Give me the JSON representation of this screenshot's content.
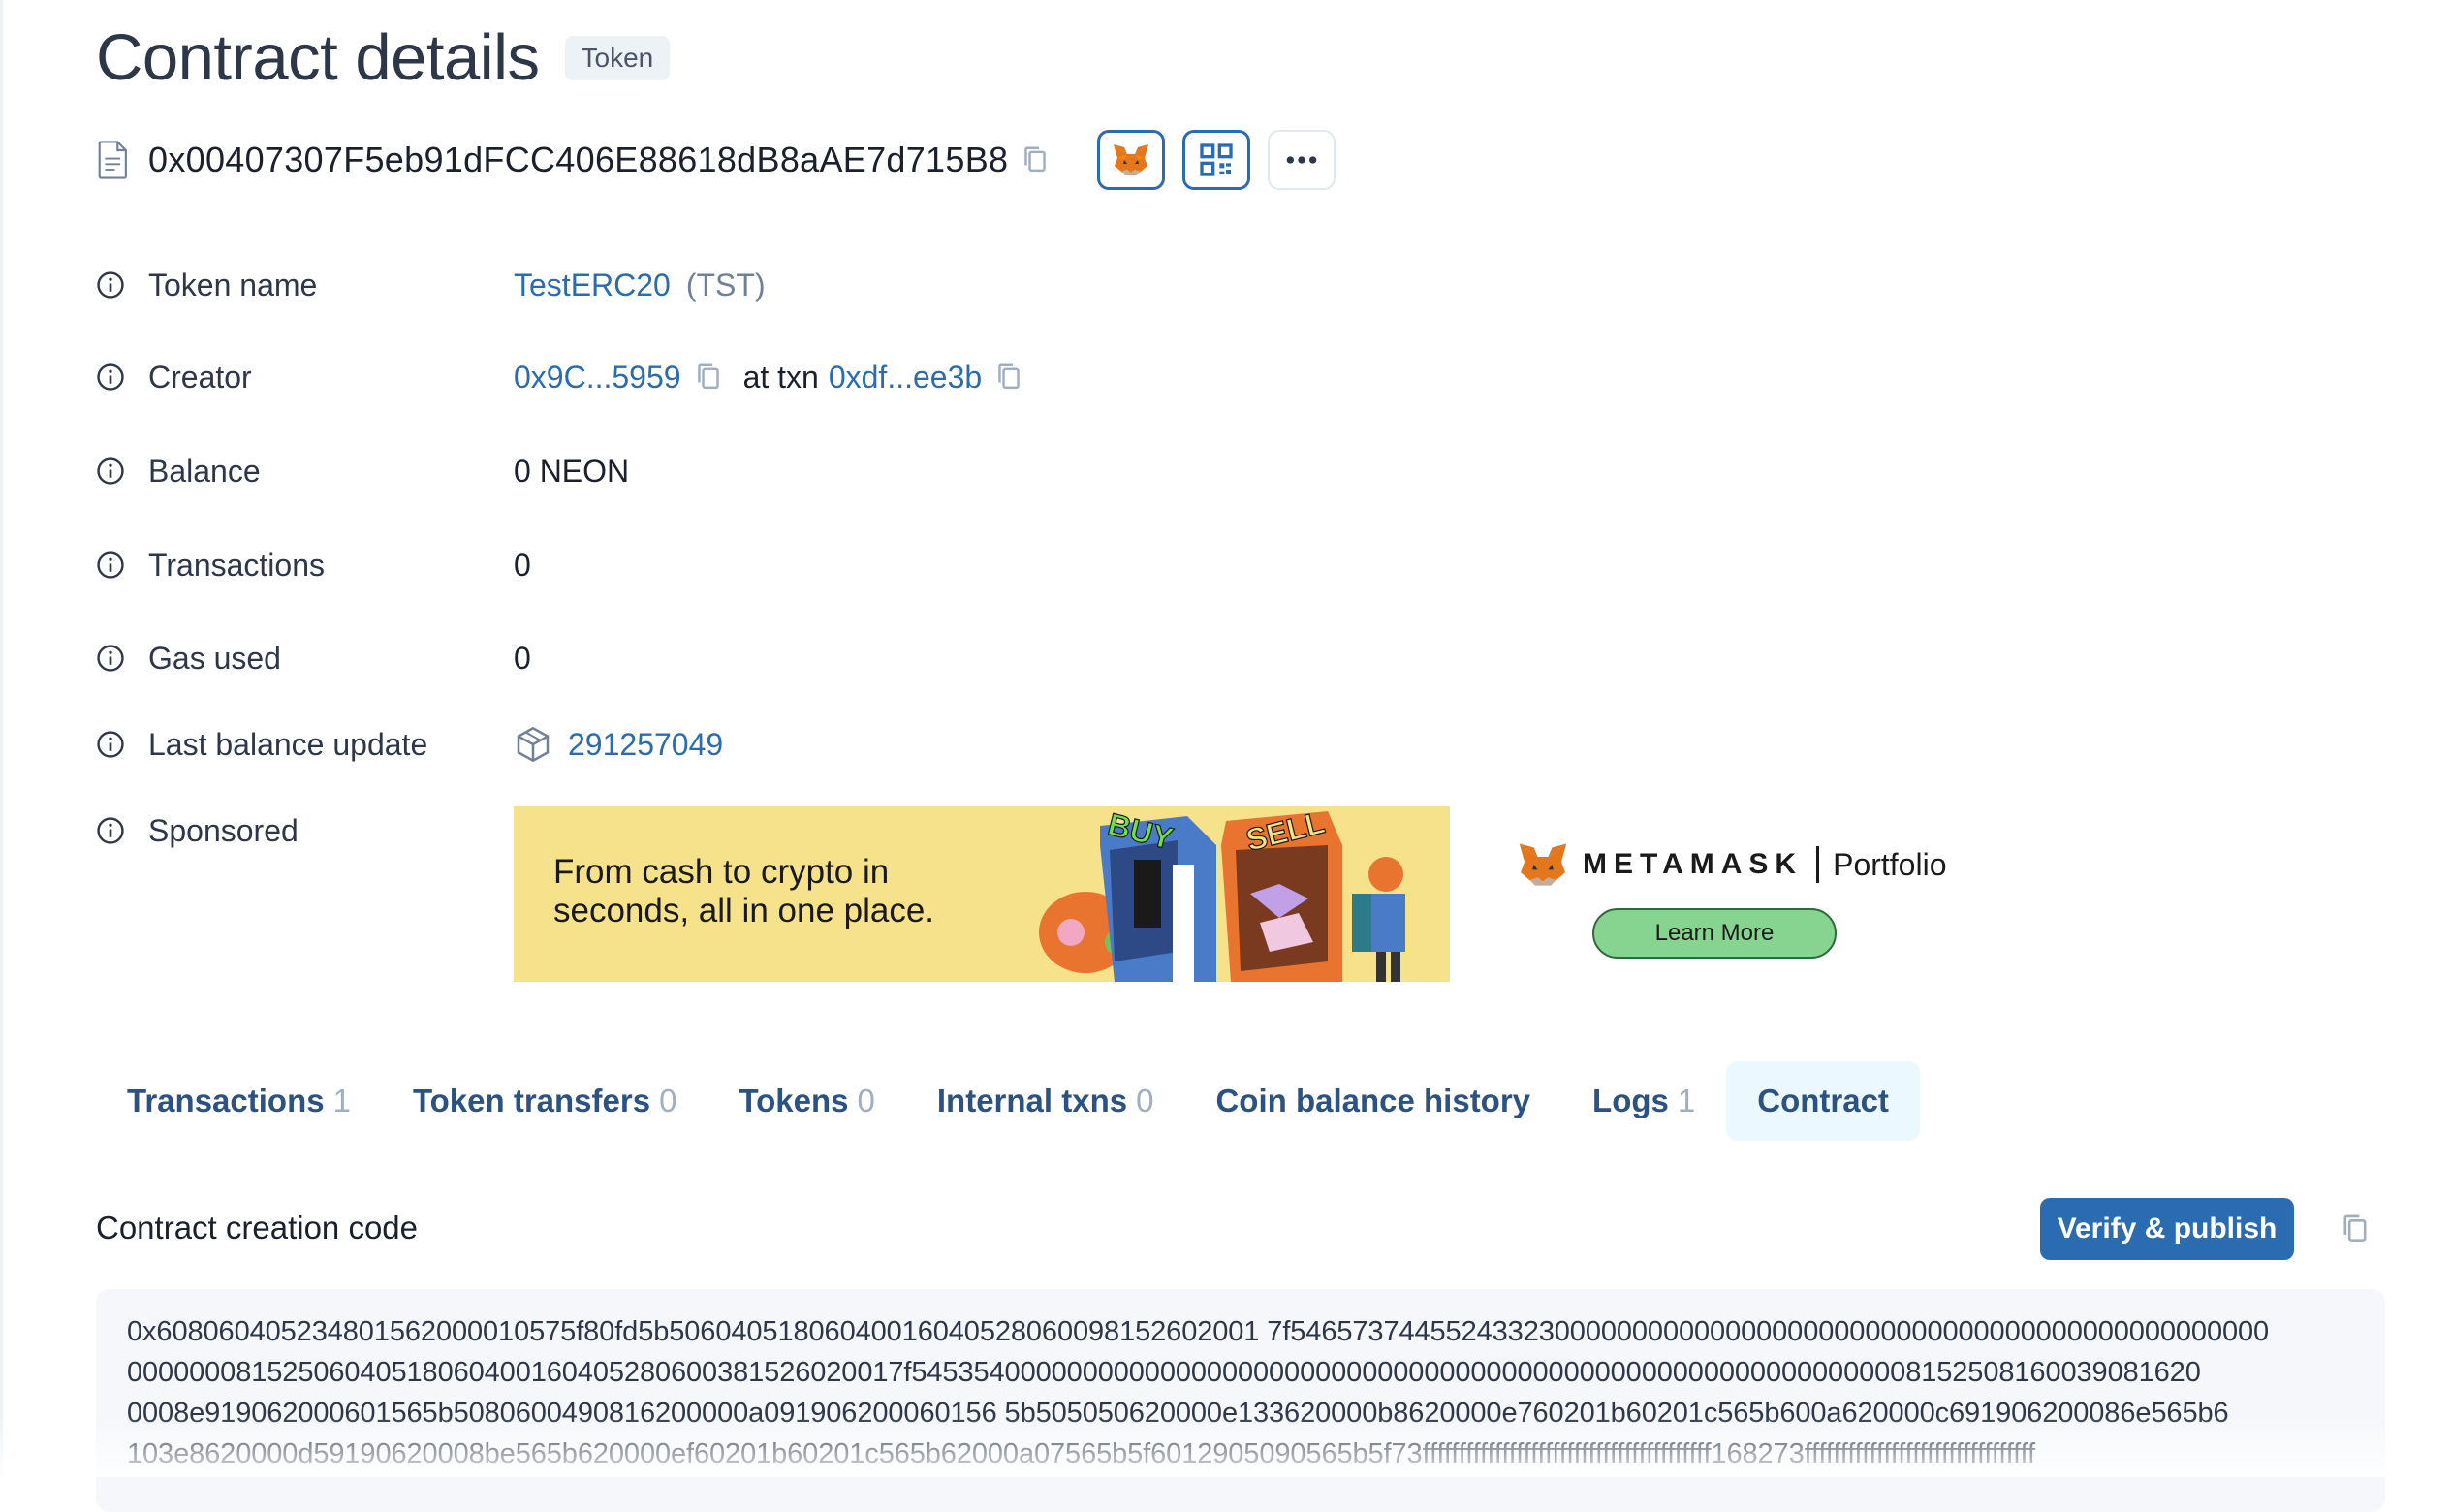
{
  "header": {
    "title": "Contract details",
    "badge": "Token",
    "address": "0x00407307F5eb91dFCC406E88618dB8aAE7d715B8"
  },
  "details": {
    "token_name": {
      "label": "Token name",
      "value": "TestERC20",
      "symbol": "(TST)"
    },
    "creator": {
      "label": "Creator",
      "address": "0x9C...5959",
      "at_txn_text": "at txn",
      "txn": "0xdf...ee3b"
    },
    "balance": {
      "label": "Balance",
      "value": "0 NEON"
    },
    "transactions": {
      "label": "Transactions",
      "value": "0"
    },
    "gas_used": {
      "label": "Gas used",
      "value": "0"
    },
    "last_balance_update": {
      "label": "Last balance update",
      "value": "291257049"
    },
    "sponsored": {
      "label": "Sponsored"
    }
  },
  "ad": {
    "text_line1": "From cash to crypto in",
    "text_line2": "seconds, all in one place.",
    "art_word_buy": "BUY",
    "art_word_sell": "SELL",
    "brand_name": "METAMASK",
    "brand_product": "Portfolio",
    "cta": "Learn More"
  },
  "tabs": [
    {
      "label": "Transactions",
      "count": "1",
      "active": false
    },
    {
      "label": "Token transfers",
      "count": "0",
      "active": false
    },
    {
      "label": "Tokens",
      "count": "0",
      "active": false
    },
    {
      "label": "Internal txns",
      "count": "0",
      "active": false
    },
    {
      "label": "Coin balance history",
      "count": "",
      "active": false
    },
    {
      "label": "Logs",
      "count": "1",
      "active": false
    },
    {
      "label": "Contract",
      "count": "",
      "active": true
    }
  ],
  "contract_code": {
    "title": "Contract creation code",
    "verify_button": "Verify & publish",
    "lines": [
      "0x608060405234801562000010575f80fd5b50604051806040016040528060098152602001 7f546573744552433230000000000000000000000000000000000000000000000",
      "00000008152506040518060400160405280600381526020017f54535400000000000000000000000000000000000000000000000000000000008152508160039081620",
      "0008e919062000601565b5080600490816200000a091906200060156 5b505050620000e133620000b8620000e760201b60201c565b600a620000c691906200086e565b6",
      "103e8620000d59190620008be565b620000ef60201b60201c565b62000a07565b5f6012905090565b5f73ffffffffffffffffffffffffffffffffffffffff168273ffffffffffffffffffffffffffffffff"
    ]
  },
  "colors": {
    "link": "#2b6cb0",
    "tab_text": "#2c5282",
    "active_tab_bg": "#ebf8ff",
    "verify_bg": "#2b6cb0",
    "ad_bg": "#f5e28a",
    "learn_more_bg": "#86d48f"
  }
}
